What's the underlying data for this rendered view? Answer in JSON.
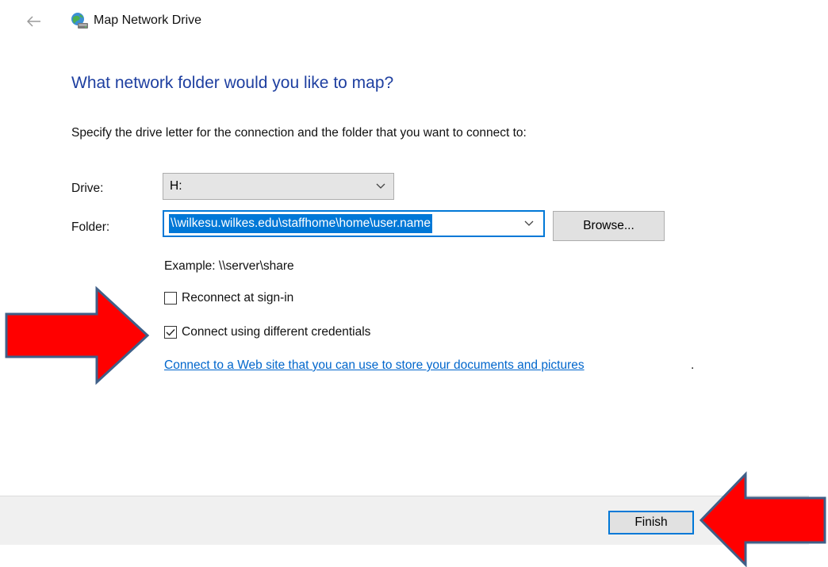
{
  "window": {
    "title": "Map Network Drive",
    "back_icon": "back-arrow-icon",
    "app_icon": "network-drive-icon"
  },
  "page": {
    "heading": "What network folder would you like to map?",
    "instruction": "Specify the drive letter for the connection and the folder that you want to connect to:"
  },
  "form": {
    "drive_label": "Drive:",
    "drive_value": "H:",
    "folder_label": "Folder:",
    "folder_value": "\\\\wilkesu.wilkes.edu\\staffhome\\home\\user.name",
    "browse_label": "Browse...",
    "example_text": "Example: \\\\server\\share",
    "reconnect_label": "Reconnect at sign-in",
    "reconnect_checked": false,
    "credentials_label": "Connect using different credentials",
    "credentials_checked": true,
    "web_link_text": "Connect to a Web site that you can use to store your documents and pictures",
    "web_link_suffix": "."
  },
  "footer": {
    "finish_label": "Finish"
  },
  "annotations": {
    "arrow_color": "#ff0000",
    "arrow_outline": "#3f5f88"
  },
  "colors": {
    "heading": "#1e3fa0",
    "accent": "#0078d7",
    "link": "#0066cc"
  }
}
